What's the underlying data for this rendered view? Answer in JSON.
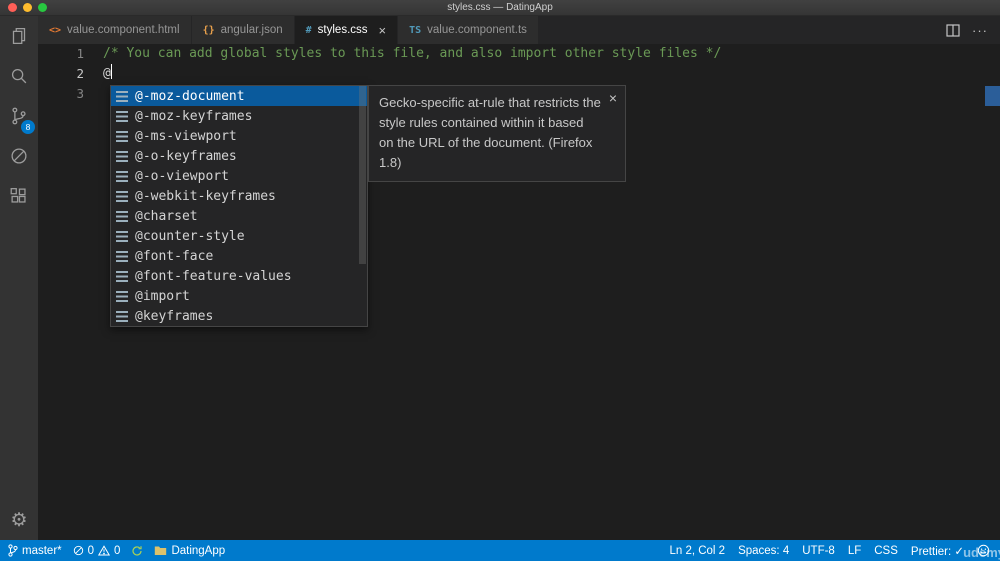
{
  "window": {
    "title": "styles.css — DatingApp"
  },
  "activity_bar": {
    "items": [
      {
        "id": "explorer"
      },
      {
        "id": "search"
      },
      {
        "id": "source-control",
        "badge": "8"
      },
      {
        "id": "debug"
      },
      {
        "id": "extensions"
      }
    ],
    "settings_glyph": "⚙"
  },
  "tabbar": {
    "tabs": [
      {
        "label": "value.component.html",
        "icon": "html-icon",
        "icon_glyph": "<>",
        "active": false
      },
      {
        "label": "angular.json",
        "icon": "json-icon",
        "icon_glyph": "{}",
        "active": false
      },
      {
        "label": "styles.css",
        "icon": "css-icon",
        "icon_glyph": "#",
        "active": true,
        "close_glyph": "×"
      },
      {
        "label": "value.component.ts",
        "icon": "ts-icon",
        "icon_glyph": "TS",
        "active": false
      }
    ],
    "more_glyph": "···"
  },
  "editor": {
    "lines": [
      {
        "number": "1",
        "text": "/* You can add global styles to this file, and also import other style files */"
      },
      {
        "number": "2",
        "text": "@"
      },
      {
        "number": "3",
        "text": ""
      }
    ]
  },
  "suggest": {
    "selected_index": 0,
    "items": [
      {
        "label": "@-moz-document"
      },
      {
        "label": "@-moz-keyframes"
      },
      {
        "label": "@-ms-viewport"
      },
      {
        "label": "@-o-keyframes"
      },
      {
        "label": "@-o-viewport"
      },
      {
        "label": "@-webkit-keyframes"
      },
      {
        "label": "@charset"
      },
      {
        "label": "@counter-style"
      },
      {
        "label": "@font-face"
      },
      {
        "label": "@font-feature-values"
      },
      {
        "label": "@import"
      },
      {
        "label": "@keyframes"
      }
    ]
  },
  "doc_popup": {
    "text": "Gecko-specific at-rule that restricts the style rules contained within it based on the URL of the document. (Firefox 1.8)",
    "close_glyph": "×"
  },
  "statusbar": {
    "branch": "master*",
    "errors": "0",
    "warnings": "0",
    "project": "DatingApp",
    "cursor": "Ln 2, Col 2",
    "indent": "Spaces: 4",
    "encoding": "UTF-8",
    "eol": "LF",
    "language": "CSS",
    "formatter": "Prettier: ✓"
  },
  "watermark": "udemy",
  "colors": {
    "statusbar_background": "#007acc",
    "suggest_selection": "#0a5a9c",
    "comment_green": "#6a9955",
    "badge_blue": "#007acc",
    "overview_ruler_mark": "#3794ff"
  }
}
